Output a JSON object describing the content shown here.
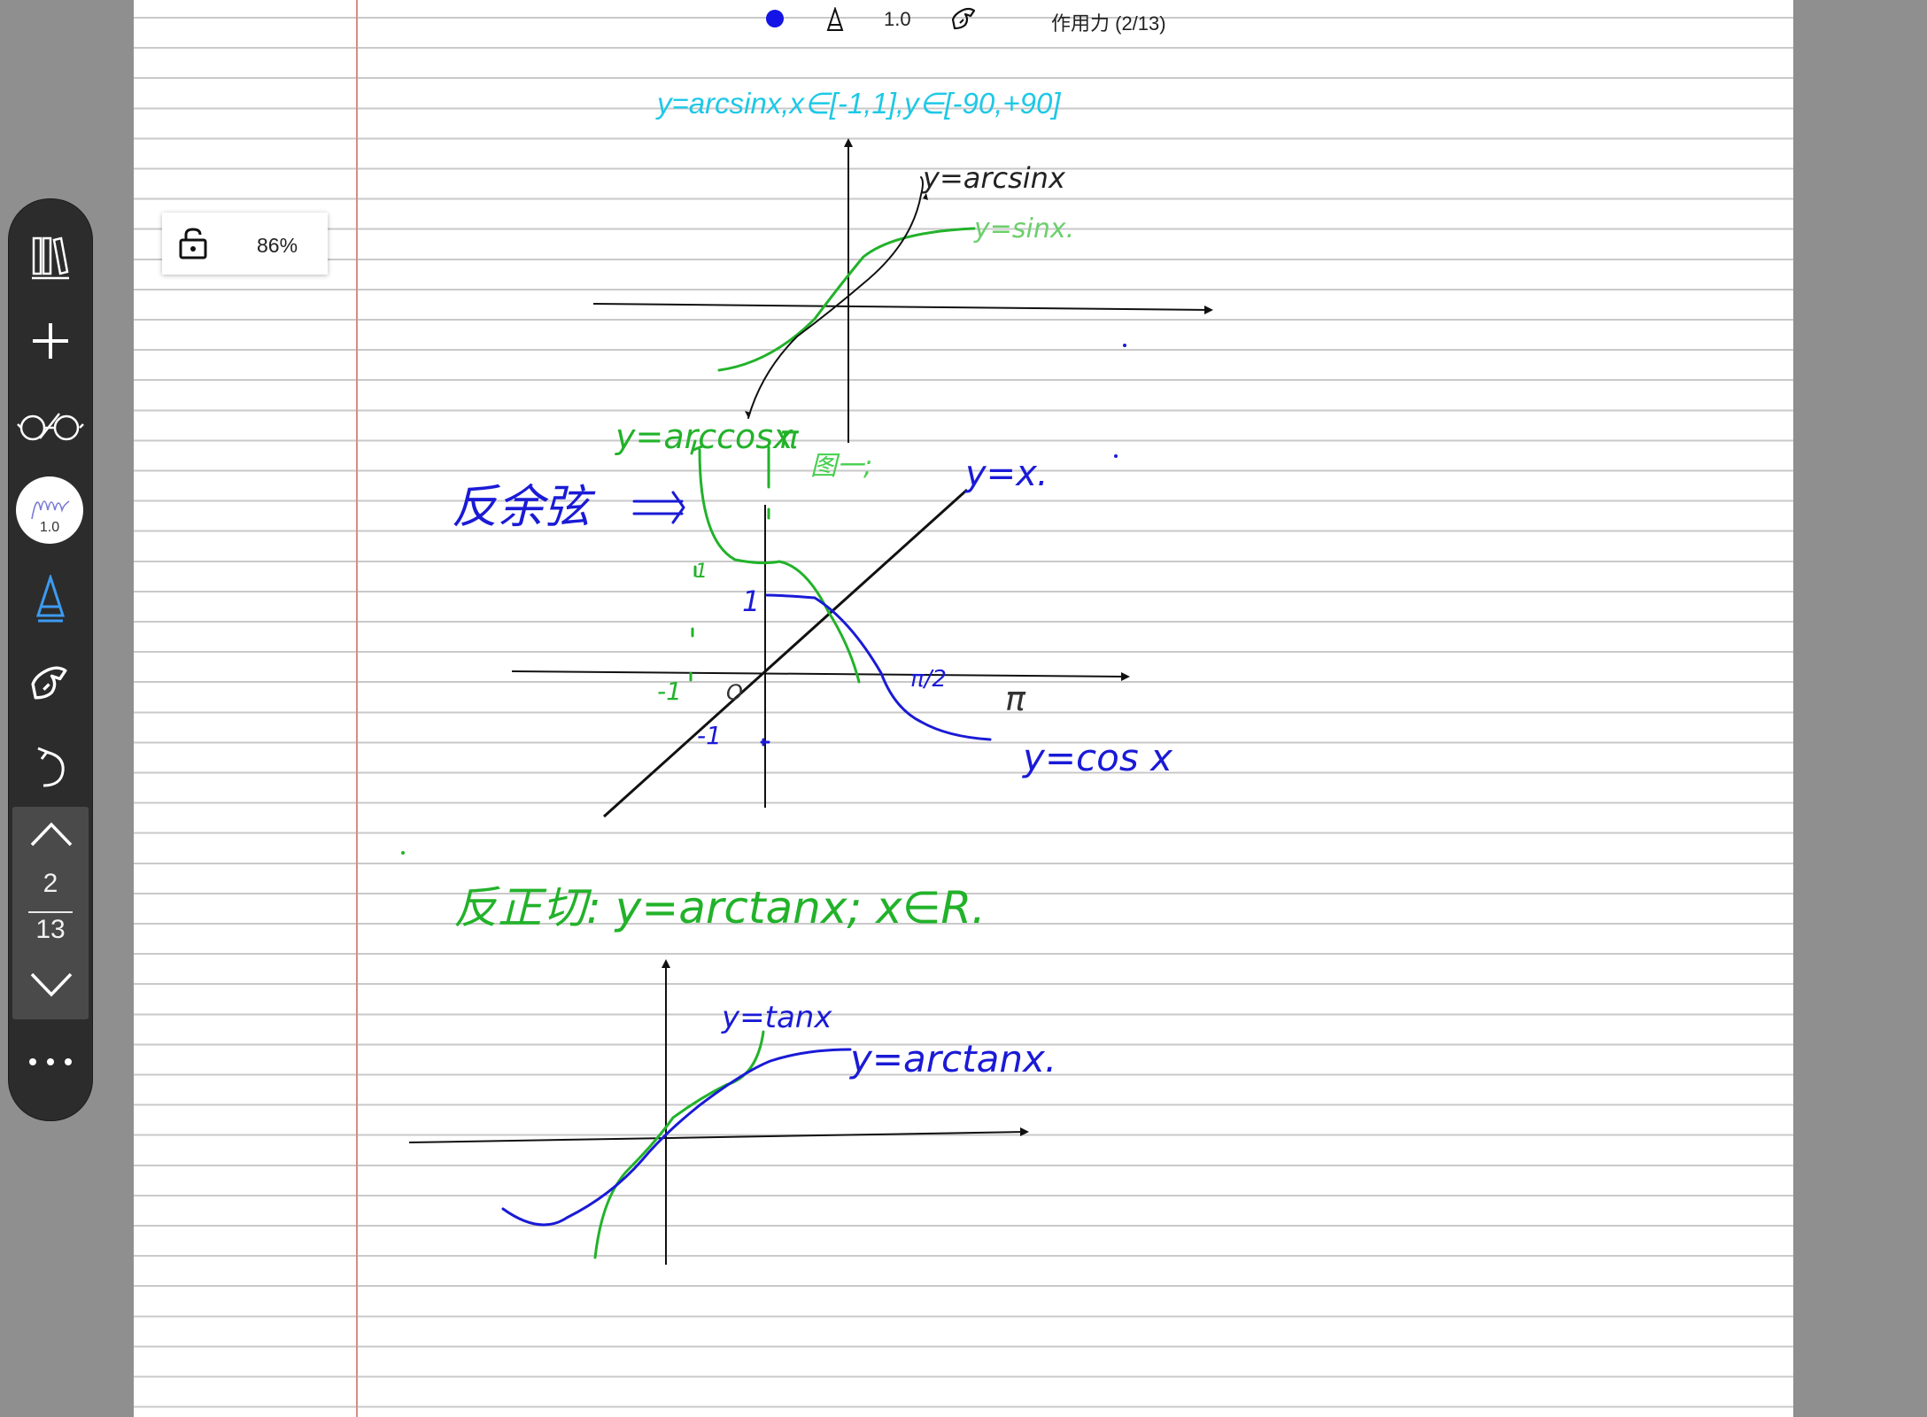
{
  "topbar": {
    "pen_width": "1.0",
    "notebook_title": "作用力 (2/13)",
    "ink_color": "#1414e6"
  },
  "zoom": {
    "percent": "86%"
  },
  "toolbar": {
    "pen_width": "1.0",
    "current_page": "2",
    "total_pages": "13",
    "items": [
      "library-icon",
      "add-icon",
      "glasses-icon",
      "pen-style-icon",
      "pen-icon",
      "hand-tool-icon",
      "undo-icon",
      "page-up-icon",
      "page-down-icon",
      "more-icon"
    ]
  },
  "note": {
    "heading": "y=arcsinx,x∈[-1,1],y∈[-90,+90]",
    "label_arcsin": "y=arcsinx",
    "label_sin": "y=sinx.",
    "label_arccos": "y=arccosx",
    "label_pi_top": "π",
    "label_fig": "图一;",
    "label_yx": "y=x.",
    "label_fanyuxian": "反余弦",
    "label_one_a": "1",
    "label_one_b": "1",
    "label_neg_one_x": "-1",
    "label_neg_one_y": "-1",
    "label_origin": "O",
    "label_pi_half": "π/2",
    "label_pi": "π",
    "label_cos": "y=cos x",
    "label_arctan_title": "反正切: y=arctanx; x∈R.",
    "label_tan": "y=tanx",
    "label_arctan": "y=arctanx.",
    "colors": {
      "green": "#22b22a",
      "blue": "#1a1ad6",
      "heading": "#1ec8e6"
    }
  }
}
